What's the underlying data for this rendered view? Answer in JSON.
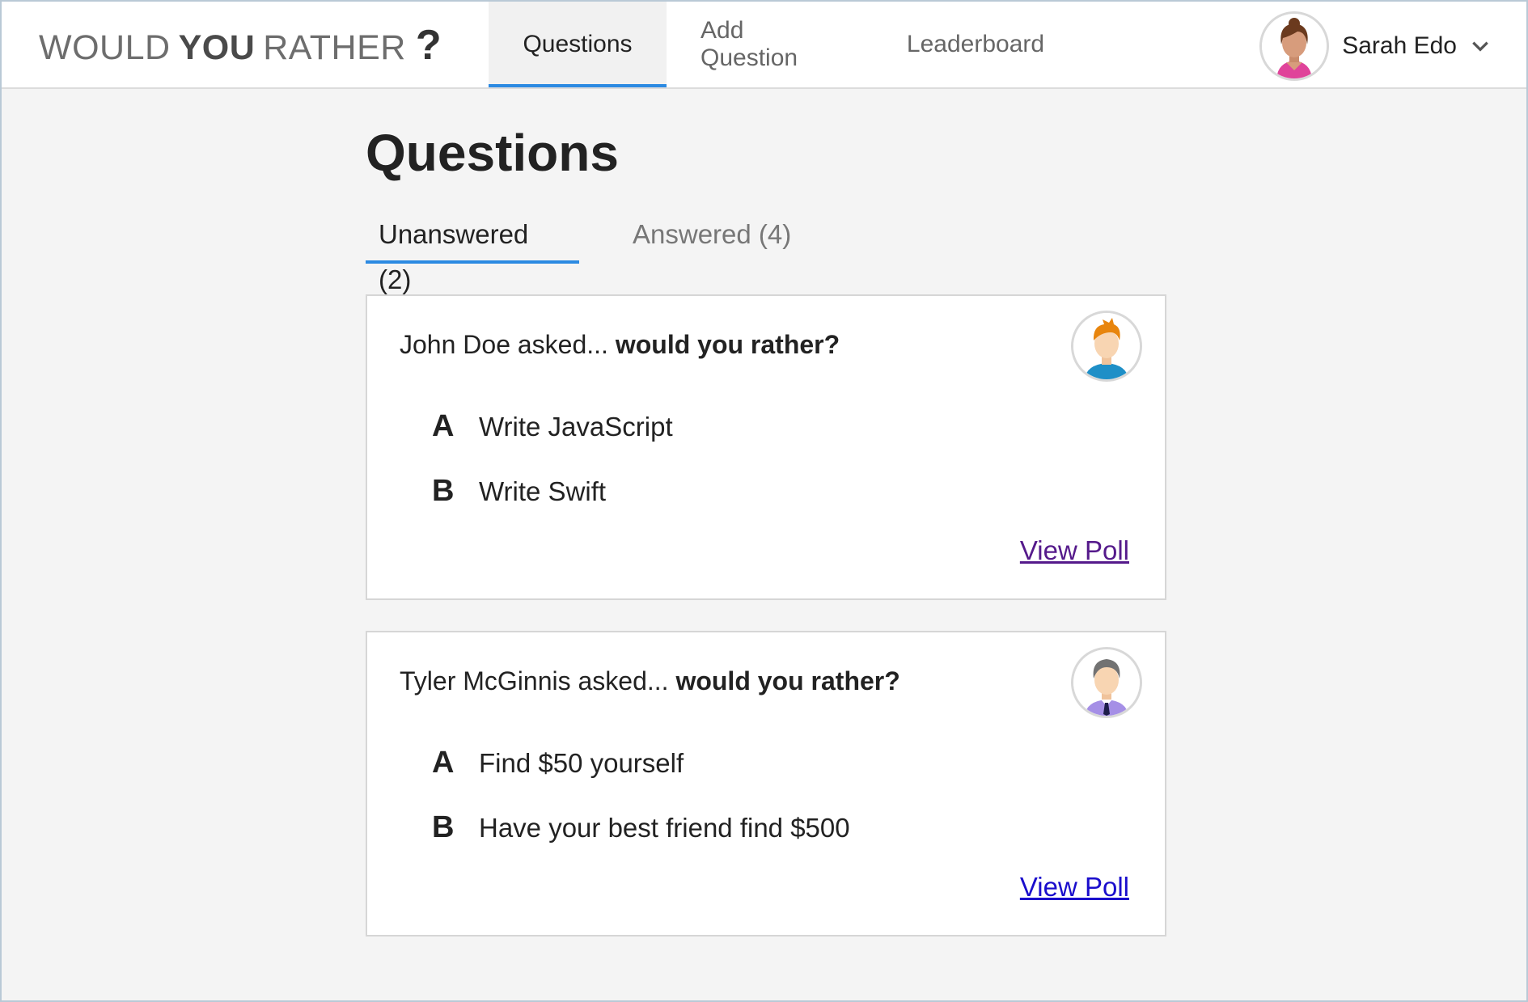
{
  "app": {
    "logo": {
      "word1": "WOULD",
      "word2": "YOU",
      "word3": "RATHER",
      "mark": "?"
    }
  },
  "nav": {
    "items": [
      {
        "label": "Questions",
        "active": true
      },
      {
        "label": "Add Question",
        "active": false
      },
      {
        "label": "Leaderboard",
        "active": false
      }
    ]
  },
  "user": {
    "name": "Sarah Edo",
    "avatar_icon": "avatar-woman-icon",
    "menu_icon": "chevron-down-icon"
  },
  "page": {
    "title": "Questions"
  },
  "tabs": [
    {
      "label": "Unanswered (2)",
      "active": true
    },
    {
      "label": "Answered (4)",
      "active": false
    }
  ],
  "questions": [
    {
      "author": "John Doe asked...",
      "prompt": "would you rather?",
      "avatar_icon": "avatar-orange-hair-icon",
      "options": [
        {
          "letter": "A",
          "text": "Write JavaScript"
        },
        {
          "letter": "B",
          "text": "Write Swift"
        }
      ],
      "link": "View Poll",
      "link_color": "#551a8b"
    },
    {
      "author": "Tyler McGinnis asked...",
      "prompt": "would you rather?",
      "avatar_icon": "avatar-man-tie-icon",
      "options": [
        {
          "letter": "A",
          "text": "Find $50 yourself"
        },
        {
          "letter": "B",
          "text": "Have your best friend find $500"
        }
      ],
      "link": "View Poll",
      "link_color": "#1a0dcc"
    }
  ],
  "colors": {
    "accent": "#2c8ae2",
    "background": "#f4f4f4",
    "card": "#ffffff"
  }
}
